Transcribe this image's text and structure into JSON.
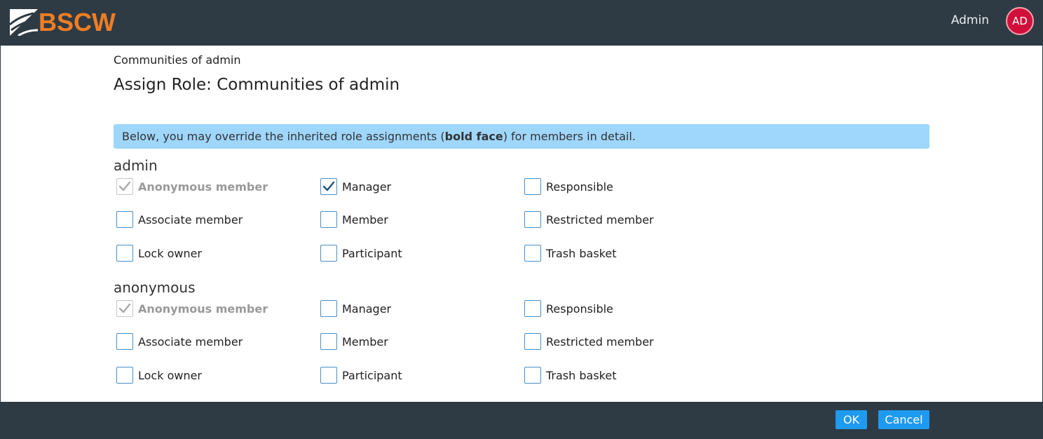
{
  "brand": {
    "name": "BSCW",
    "color": "#f07d23"
  },
  "header": {
    "user_name": "Admin",
    "avatar_initials": "AD"
  },
  "breadcrumb": "Communities of admin",
  "title": "Assign Role: Communities of admin",
  "info": {
    "prefix": "Below, you may override the inherited role assignments (",
    "bold": "bold face",
    "suffix": ") for members in detail."
  },
  "sections": [
    {
      "name": "admin",
      "roles": [
        {
          "label": "Anonymous member",
          "checked": true,
          "inherited": true
        },
        {
          "label": "Manager",
          "checked": true,
          "inherited": false
        },
        {
          "label": "Responsible",
          "checked": false,
          "inherited": false
        },
        {
          "label": "Associate member",
          "checked": false,
          "inherited": false
        },
        {
          "label": "Member",
          "checked": false,
          "inherited": false
        },
        {
          "label": "Restricted member",
          "checked": false,
          "inherited": false
        },
        {
          "label": "Lock owner",
          "checked": false,
          "inherited": false
        },
        {
          "label": "Participant",
          "checked": false,
          "inherited": false
        },
        {
          "label": "Trash basket",
          "checked": false,
          "inherited": false
        }
      ]
    },
    {
      "name": "anonymous",
      "roles": [
        {
          "label": "Anonymous member",
          "checked": true,
          "inherited": true
        },
        {
          "label": "Manager",
          "checked": false,
          "inherited": false
        },
        {
          "label": "Responsible",
          "checked": false,
          "inherited": false
        },
        {
          "label": "Associate member",
          "checked": false,
          "inherited": false
        },
        {
          "label": "Member",
          "checked": false,
          "inherited": false
        },
        {
          "label": "Restricted member",
          "checked": false,
          "inherited": false
        },
        {
          "label": "Lock owner",
          "checked": false,
          "inherited": false
        },
        {
          "label": "Participant",
          "checked": false,
          "inherited": false
        },
        {
          "label": "Trash basket",
          "checked": false,
          "inherited": false
        }
      ]
    }
  ],
  "buttons": {
    "ok": "OK",
    "cancel": "Cancel"
  }
}
